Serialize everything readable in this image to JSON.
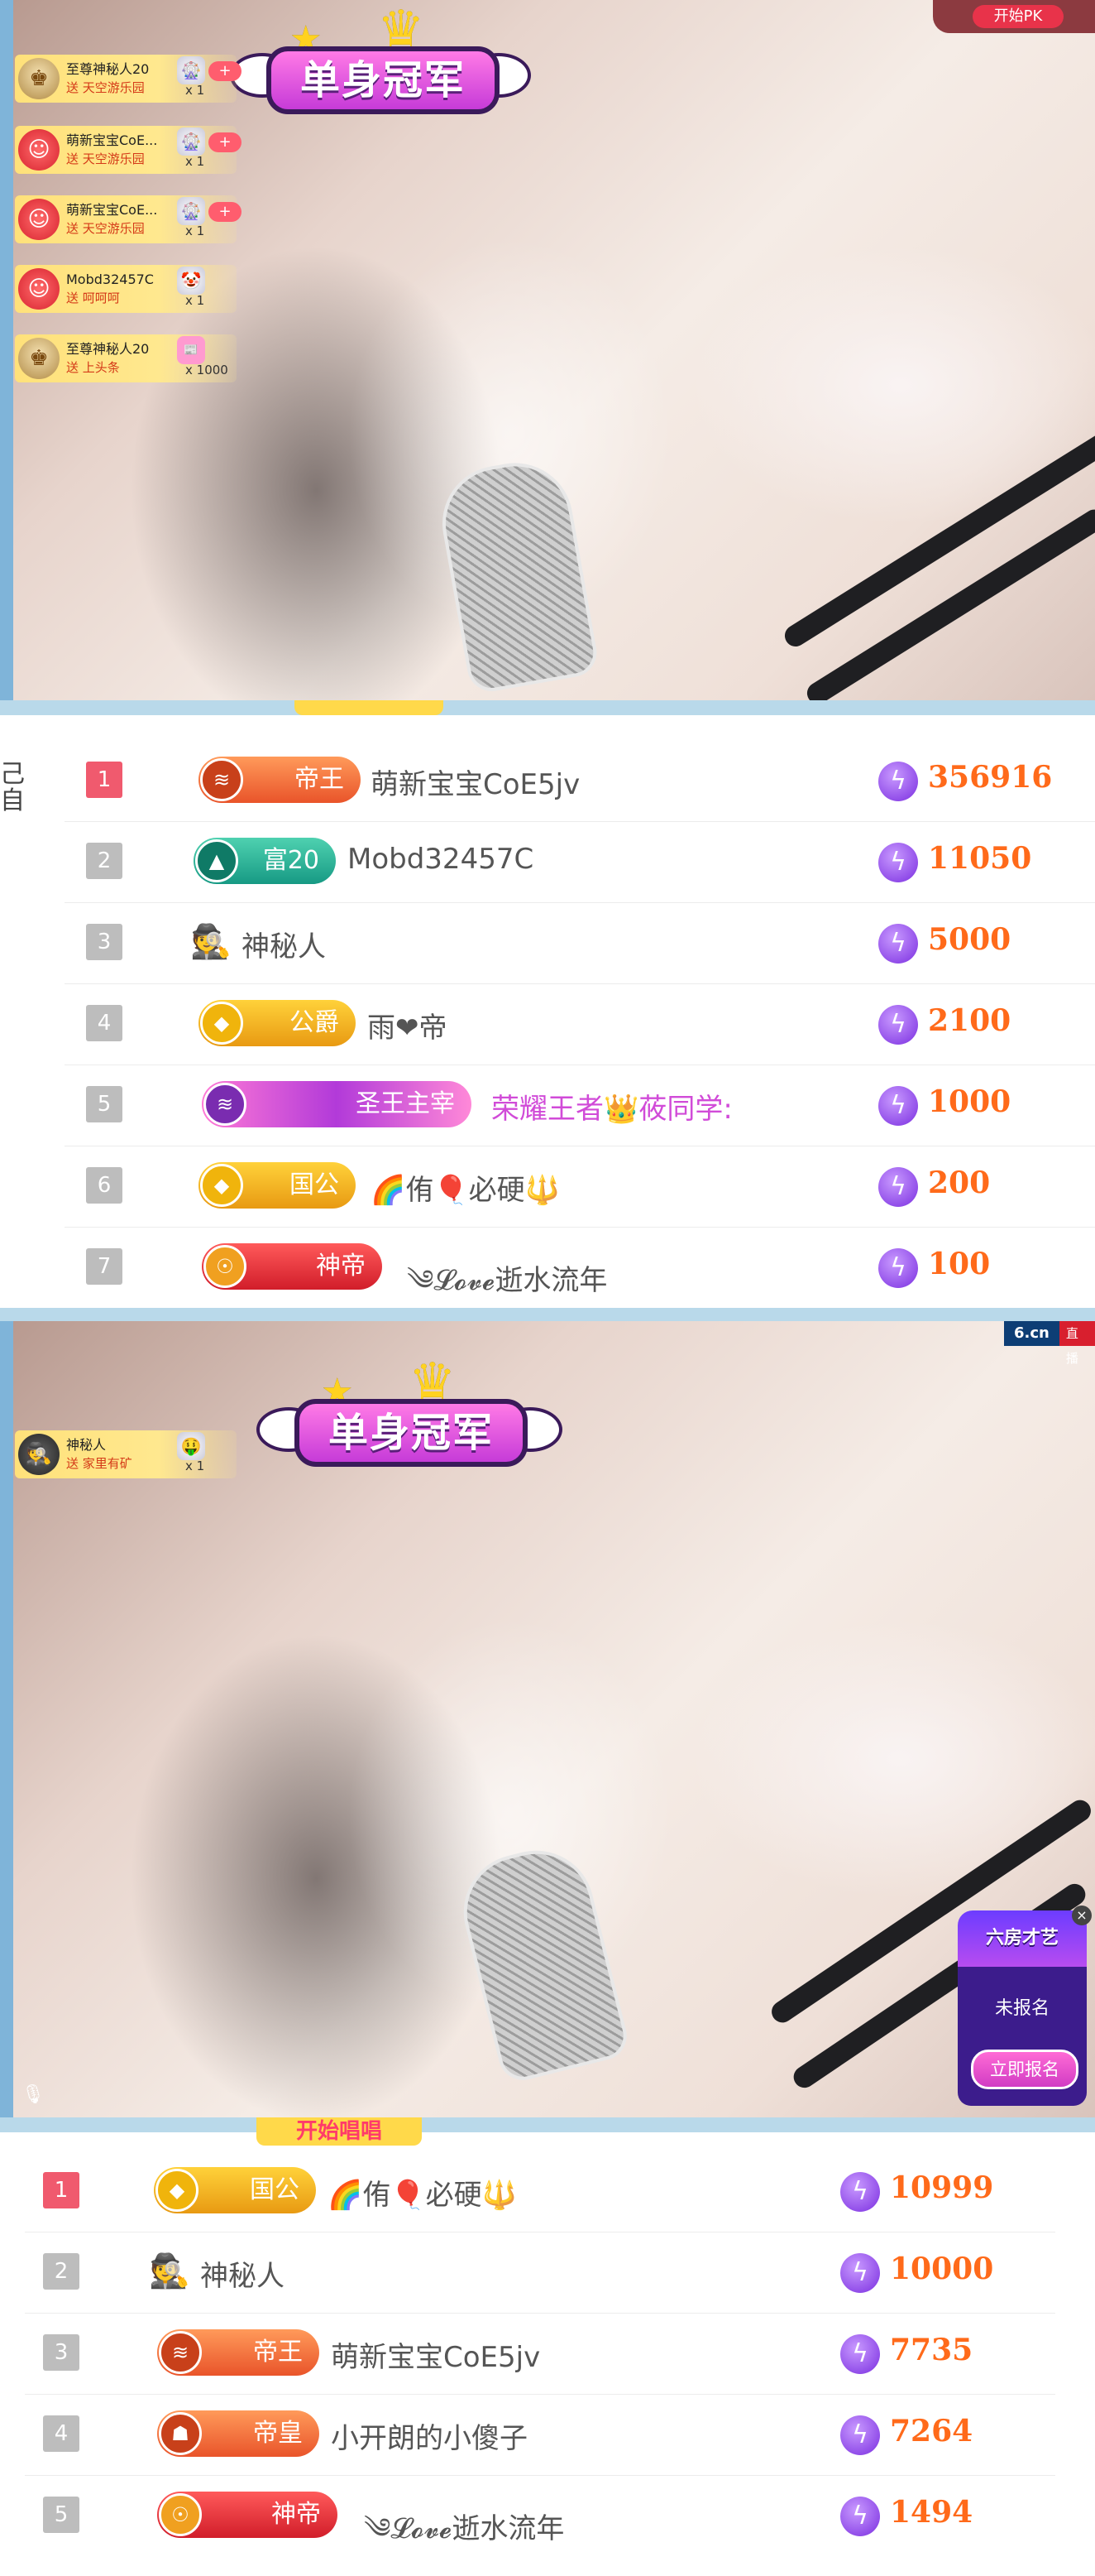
{
  "stream1": {
    "pk_button": "开始PK",
    "title_badge": "单身冠军",
    "gifts": [
      {
        "name": "至尊神秘人20",
        "action": "送 天空游乐园",
        "count": "x 1",
        "style": "gold",
        "avatar": "crown"
      },
      {
        "name": "萌新宝宝CoE...",
        "action": "送 天空游乐园",
        "count": "x 1",
        "style": "red",
        "avatar": "smile"
      },
      {
        "name": "萌新宝宝CoE...",
        "action": "送 天空游乐园",
        "count": "x 1",
        "style": "red",
        "avatar": "smile"
      },
      {
        "name": "Mobd32457C",
        "action": "送 呵呵呵",
        "count": "x 1",
        "style": "gold",
        "avatar": "smile"
      },
      {
        "name": "至尊神秘人20",
        "action": "送 上头条",
        "count": "x 1000",
        "style": "gold",
        "avatar": "crown"
      }
    ]
  },
  "ranking1": {
    "rows": [
      {
        "rank": "1",
        "level": "帝王",
        "level_style": "orange",
        "name": "萌新宝宝CoE5jv",
        "score": "356916"
      },
      {
        "rank": "2",
        "level": "富20",
        "level_style": "teal",
        "name": "Mobd32457C",
        "score": "11050"
      },
      {
        "rank": "3",
        "level": "",
        "level_style": "none",
        "name": "神秘人",
        "score": "5000"
      },
      {
        "rank": "4",
        "level": "公爵",
        "level_style": "gold",
        "name": "雨❤帝",
        "score": "2100"
      },
      {
        "rank": "5",
        "level": "圣王主宰",
        "level_style": "purple",
        "name": "荣耀王者👑莜同学:",
        "score": "1000"
      },
      {
        "rank": "6",
        "level": "国公",
        "level_style": "gold",
        "name": "🌈侑🎈必硬🔱",
        "score": "200"
      },
      {
        "rank": "7",
        "level": "神帝",
        "level_style": "red",
        "name": "༄𝓛𝓸𝓿𝓮逝水流年",
        "score": "100"
      }
    ]
  },
  "stream2": {
    "logo": "6.cn",
    "logo_tag": "直播",
    "title_badge": "单身冠军",
    "gift": {
      "name": "神秘人",
      "action": "送 家里有矿",
      "count": "x 1"
    },
    "promo": {
      "title": "六房才艺",
      "status": "未报名",
      "button": "立即报名"
    },
    "banner": "开始唱唱"
  },
  "ranking2": {
    "rows": [
      {
        "rank": "1",
        "level": "国公",
        "level_style": "gold",
        "name": "🌈侑🎈必硬🔱",
        "score": "10999"
      },
      {
        "rank": "2",
        "level": "",
        "level_style": "none",
        "name": "神秘人",
        "score": "10000"
      },
      {
        "rank": "3",
        "level": "帝王",
        "level_style": "orange",
        "name": "萌新宝宝CoE5jv",
        "score": "7735"
      },
      {
        "rank": "4",
        "level": "帝皇",
        "level_style": "orange",
        "name": "小开朗的小傻子",
        "score": "7264"
      },
      {
        "rank": "5",
        "level": "神帝",
        "level_style": "red",
        "name": "༄𝓛𝓸𝓿𝓮逝水流年",
        "score": "1494"
      }
    ]
  },
  "colors": {
    "score": "#ff6a1a",
    "rank_top": "#f05a6e",
    "rank_other": "#bdbdbd",
    "divider": "#b9d9ea"
  }
}
